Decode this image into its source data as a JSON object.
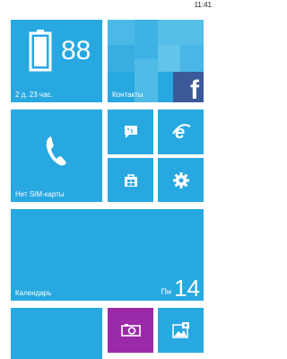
{
  "status_bar": {
    "time": "11:41"
  },
  "tiles": {
    "battery": {
      "percent": "88",
      "remaining": "2 д. 23 час.",
      "icon": "battery-icon",
      "level": 0.88
    },
    "contacts": {
      "label": "Контакты",
      "badge_letter": "f",
      "icon": "facebook-icon"
    },
    "phone": {
      "label": "Нет SIM-карты",
      "icon": "phone-icon"
    },
    "messaging": {
      "icon": "messaging-icon"
    },
    "internet_explorer": {
      "icon": "internet-explorer-icon"
    },
    "store": {
      "icon": "store-icon"
    },
    "settings": {
      "icon": "gear-icon"
    },
    "calendar": {
      "label": "Календарь",
      "weekday": "Пн",
      "day": "14"
    },
    "bottom_left": {},
    "camera": {
      "icon": "camera-icon"
    },
    "photos": {
      "icon": "photos-icon"
    }
  },
  "colors": {
    "tile_blue": "#27a8e1",
    "camera_purple": "#9b2aa8",
    "facebook_blue": "#3b5998"
  }
}
